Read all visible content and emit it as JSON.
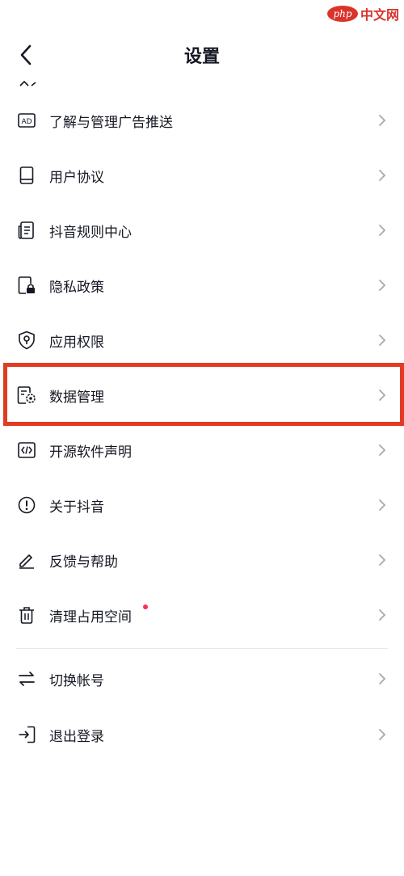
{
  "header": {
    "title": "设置"
  },
  "watermark": {
    "logo_text": "php",
    "text": "中文网"
  },
  "menu_items": [
    {
      "label": "了解与管理广告推送",
      "icon": "ad-icon"
    },
    {
      "label": "用户协议",
      "icon": "book-icon"
    },
    {
      "label": "抖音规则中心",
      "icon": "rules-document-icon"
    },
    {
      "label": "隐私政策",
      "icon": "privacy-lock-icon"
    },
    {
      "label": "应用权限",
      "icon": "permission-shield-icon"
    },
    {
      "label": "数据管理",
      "icon": "data-settings-icon",
      "highlighted": true
    },
    {
      "label": "开源软件声明",
      "icon": "code-icon"
    },
    {
      "label": "关于抖音",
      "icon": "info-icon"
    },
    {
      "label": "反馈与帮助",
      "icon": "pencil-icon"
    },
    {
      "label": "清理占用空间",
      "icon": "trash-icon",
      "badge": "red-dot"
    }
  ],
  "account_items": [
    {
      "label": "切换帐号",
      "icon": "switch-arrows-icon"
    },
    {
      "label": "退出登录",
      "icon": "logout-icon"
    }
  ],
  "colors": {
    "highlight_border": "#e23b22",
    "badge_dot": "#fe2c55",
    "text": "#161823",
    "chevron": "#a8a9ad"
  }
}
